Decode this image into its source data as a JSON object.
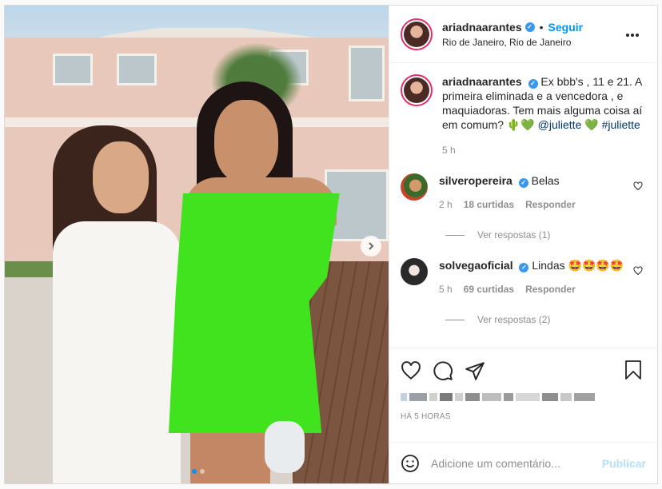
{
  "header": {
    "username": "ariadnaarantes",
    "follow_label": "Seguir",
    "location": "Rio de Janeiro, Rio de Janeiro",
    "bullet": "•",
    "more_label": "•••"
  },
  "caption": {
    "username": "ariadnaarantes",
    "text": "Ex bbb's , 11 e 21. A primeira eliminada e a vencedora , e maquiadoras. Tem mais alguma coisa aí em comum? 🌵💚 ",
    "mention": "@juliette",
    "hashtag_prefix": " 💚 ",
    "hashtag": "#juliette",
    "age": "5 h"
  },
  "comments": [
    {
      "username": "silveropereira",
      "text": "Belas",
      "age": "2 h",
      "likes": "18 curtidas",
      "reply_label": "Responder",
      "view_replies": "Ver respostas (1)"
    },
    {
      "username": "solvegaoficial",
      "text": "Lindas 🤩🤩🤩🤩",
      "age": "5 h",
      "likes": "69 curtidas",
      "reply_label": "Responder",
      "view_replies": "Ver respostas (2)"
    }
  ],
  "post_meta": {
    "time_ago": "HÁ 5 HORAS"
  },
  "comment_input": {
    "placeholder": "Adicione um comentário...",
    "publish_label": "Publicar"
  },
  "icons": {
    "like": "heart-icon",
    "comment": "comment-icon",
    "share": "share-icon",
    "save": "bookmark-icon",
    "emoji": "emoji-icon",
    "next": "chevron-right-icon"
  },
  "colors": {
    "accent": "#0095f6",
    "verified": "#3897f0",
    "muted": "#8e8e8e",
    "publish_disabled": "#b2dffc"
  },
  "carousel": {
    "count": 2,
    "active_index": 0
  }
}
